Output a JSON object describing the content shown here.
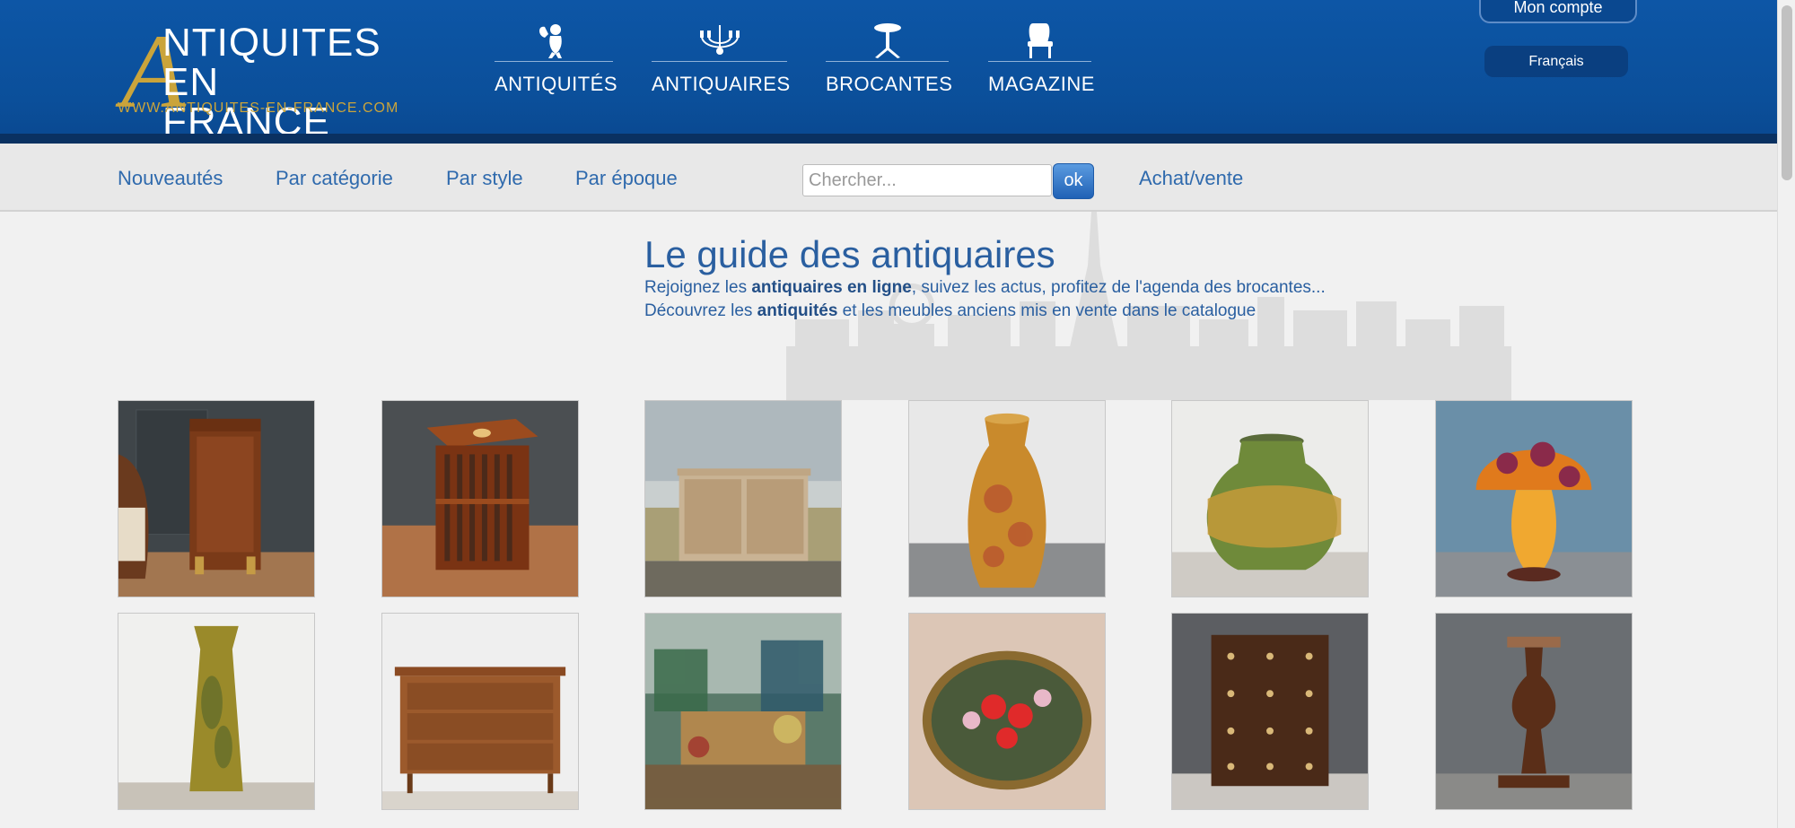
{
  "logo": {
    "initial": "A",
    "line1": "NTIQUITES",
    "line2": "EN FRANCE",
    "url": "WWW.ANTIQUITES-EN-FRANCE.COM"
  },
  "main_nav": [
    {
      "label": "ANTIQUITÉS",
      "icon": "cherub-icon"
    },
    {
      "label": "ANTIQUAIRES",
      "icon": "chandelier-icon"
    },
    {
      "label": "BROCANTES",
      "icon": "gueridon-table-icon"
    },
    {
      "label": "MAGAZINE",
      "icon": "armchair-icon"
    }
  ],
  "account": {
    "label": "Mon compte"
  },
  "language": {
    "label": "Français"
  },
  "sub_nav": {
    "links": [
      "Nouveautés",
      "Par catégorie",
      "Par style",
      "Par époque"
    ],
    "search_placeholder": "Chercher...",
    "search_button": "ok",
    "extra_link": "Achat/vente"
  },
  "guide": {
    "title": "Le guide des antiquaires",
    "line1_before": "Rejoignez les ",
    "line1_bold": "antiquaires en ligne",
    "line1_after": ", suivez les actus, profitez de l'agenda des brocantes...",
    "line2_before": "Découvrez les ",
    "line2_bold": "antiquités",
    "line2_after": " et les meubles anciens mis en vente dans le catalogue"
  },
  "products": [
    {
      "name": "mahogany-pedestal-cabinet"
    },
    {
      "name": "revolving-bookcase"
    },
    {
      "name": "bleached-oak-sideboard"
    },
    {
      "name": "galle-rose-vase"
    },
    {
      "name": "galle-landscape-vase"
    },
    {
      "name": "galle-mushroom-lamp"
    },
    {
      "name": "galle-tall-vase"
    },
    {
      "name": "walnut-commode"
    },
    {
      "name": "impressionist-painting"
    },
    {
      "name": "oval-floral-painting"
    },
    {
      "name": "brass-studded-chest"
    },
    {
      "name": "turned-wood-pedestal"
    }
  ],
  "colors": {
    "header_blue": "#0b4f9a",
    "gold": "#caa43b",
    "link_blue": "#2f6aad",
    "title_blue": "#2a5fa0"
  }
}
